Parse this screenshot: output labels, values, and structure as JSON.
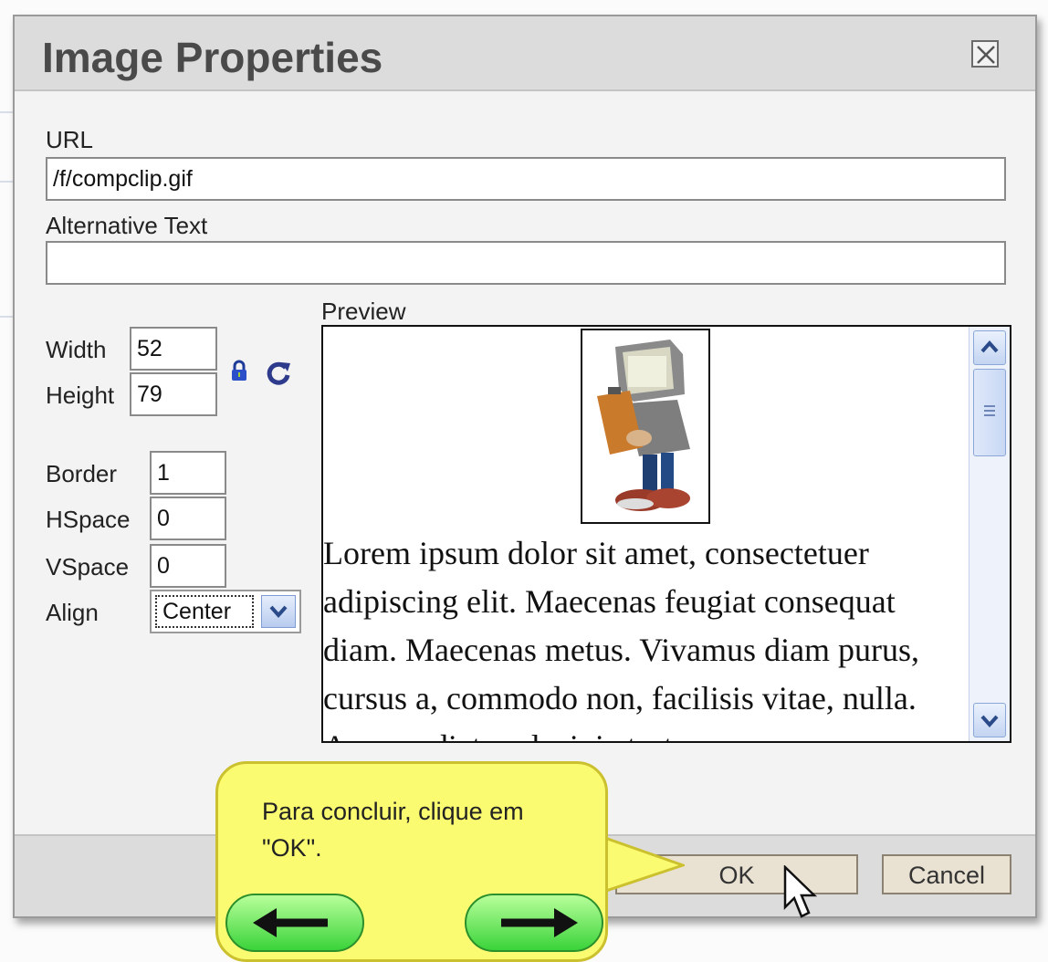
{
  "dialog": {
    "title": "Image Properties",
    "url_label": "URL",
    "url_value": "/f/compclip.gif",
    "alt_label": "Alternative Text",
    "alt_value": "",
    "width_label": "Width",
    "width_value": "52",
    "height_label": "Height",
    "height_value": "79",
    "border_label": "Border",
    "border_value": "1",
    "hspace_label": "HSpace",
    "hspace_value": "0",
    "vspace_label": "VSpace",
    "vspace_value": "0",
    "align_label": "Align",
    "align_value": "Center",
    "preview_label": "Preview",
    "preview_text": "Lorem ipsum dolor sit amet, consectetuer adipiscing elit. Maecenas feugiat consequat diam. Maecenas metus. Vivamus diam purus, cursus a, commodo non, facilisis vitae, nulla. Aenean dictum lacinia tortor.",
    "ok_label": "OK",
    "cancel_label": "Cancel"
  },
  "tooltip": {
    "text": "Para concluir, clique em \"OK\"."
  },
  "icons": {
    "close": "close-icon",
    "lock": "lock-icon",
    "refresh": "refresh-icon",
    "dropdown": "chevron-down-icon",
    "scroll_up": "chevron-up-icon",
    "scroll_down": "chevron-down-icon",
    "back": "arrow-left-icon",
    "next": "arrow-right-icon",
    "cursor": "mouse-pointer-icon"
  },
  "colors": {
    "tooltip_bg": "#fbfb72",
    "nav_button": "#3ad33a",
    "title_bar": "#dcdcdc"
  }
}
